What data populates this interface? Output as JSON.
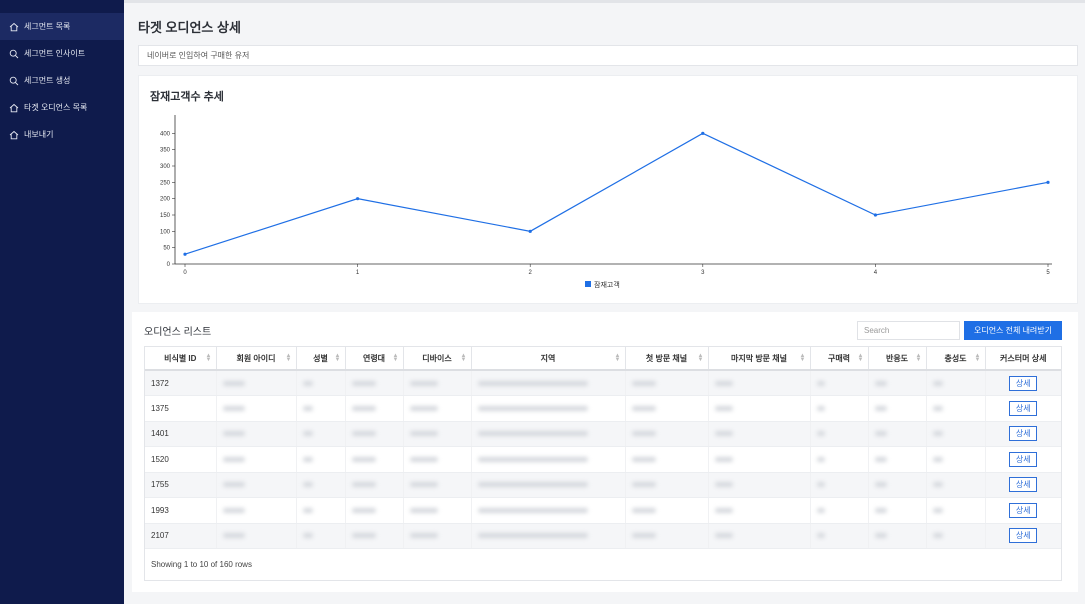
{
  "sidebar": {
    "items": [
      {
        "label": "세그먼트 목록",
        "icon": "home-icon",
        "active": true
      },
      {
        "label": "세그먼트 인사이트",
        "icon": "search-icon",
        "active": false
      },
      {
        "label": "세그먼트 생성",
        "icon": "search-icon",
        "active": false
      },
      {
        "label": "타겟 오디언스 목록",
        "icon": "home-icon",
        "active": false
      },
      {
        "label": "내보내기",
        "icon": "home-icon",
        "active": false
      }
    ]
  },
  "page": {
    "title": "타겟 오디언스 상세",
    "description": "네이버로 인입하여 구매한 유저"
  },
  "chart": {
    "title": "잠재고객수 추세"
  },
  "chart_data": {
    "type": "line",
    "x": [
      0,
      1,
      2,
      3,
      4,
      5
    ],
    "series": [
      {
        "name": "잠재고객",
        "values": [
          30,
          200,
          100,
          400,
          150,
          250
        ]
      }
    ],
    "x_tick_labels": [
      "0",
      "1",
      "2",
      "3",
      "4",
      "5"
    ],
    "y_tick_labels": [
      "0",
      "50",
      "100",
      "150",
      "200",
      "250",
      "300",
      "350",
      "400"
    ],
    "ylim": [
      0,
      450
    ],
    "xlim": [
      0,
      5
    ],
    "legend_position": "bottom-center",
    "color": "#1f6fe5",
    "grid": false
  },
  "list": {
    "title": "오디언스 리스트",
    "search_placeholder": "Search",
    "download_label": "오디언스 전체 내려받기",
    "columns": [
      "비식별 ID",
      "회원 아이디",
      "성별",
      "연령대",
      "디바이스",
      "지역",
      "첫 방문 채널",
      "마지막 방문 채널",
      "구매력",
      "반응도",
      "충성도",
      "커스터머 상세"
    ],
    "rows": [
      {
        "id": "1372",
        "action": "상세"
      },
      {
        "id": "1375",
        "action": "상세"
      },
      {
        "id": "1401",
        "action": "상세"
      },
      {
        "id": "1520",
        "action": "상세"
      },
      {
        "id": "1755",
        "action": "상세"
      },
      {
        "id": "1993",
        "action": "상세"
      },
      {
        "id": "2107",
        "action": "상세"
      }
    ],
    "footer": "Showing 1 to 10 of 160 rows"
  }
}
